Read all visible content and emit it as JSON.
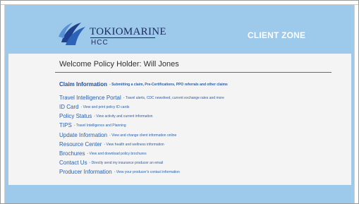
{
  "header": {
    "brand_name": "TOKIOMARINE",
    "brand_sub": "HCC",
    "zone_title": "CLIENT ZONE",
    "logo_icon": "tokio-marine-wave-logo"
  },
  "welcome": {
    "text": "Welcome Policy Holder: Will Jones"
  },
  "menu": [
    {
      "label": "Claim Information",
      "desc": "- Submitting a claim, Pre-Certifications, PPO referrals and other claims",
      "featured": true
    },
    {
      "label": "Travel Intelligence Portal",
      "desc": "- Travel alerts, CDC newsfeed, current exchange rates and more"
    },
    {
      "label": "ID Card",
      "desc": "- View and print policy ID cards"
    },
    {
      "label": "Policy Status",
      "desc": "- View activity and current information"
    },
    {
      "label": "TIPS",
      "desc": "- Travel Intelligence and Planning"
    },
    {
      "label": "Update Information",
      "desc": "- View and change client information online"
    },
    {
      "label": "Resource Center",
      "desc": "- View health and wellness information"
    },
    {
      "label": "Brochures",
      "desc": "- View and download policy brochures"
    },
    {
      "label": "Contact Us",
      "desc": "- Directly send my insurance producer an email"
    },
    {
      "label": "Producer Information",
      "desc": "- View your producer's contact information"
    }
  ],
  "colors": {
    "header_bg": "#9dc9ea",
    "link": "#2a60ad",
    "brand_navy": "#1b2a5e",
    "panel_bg": "#f4f4f4"
  }
}
